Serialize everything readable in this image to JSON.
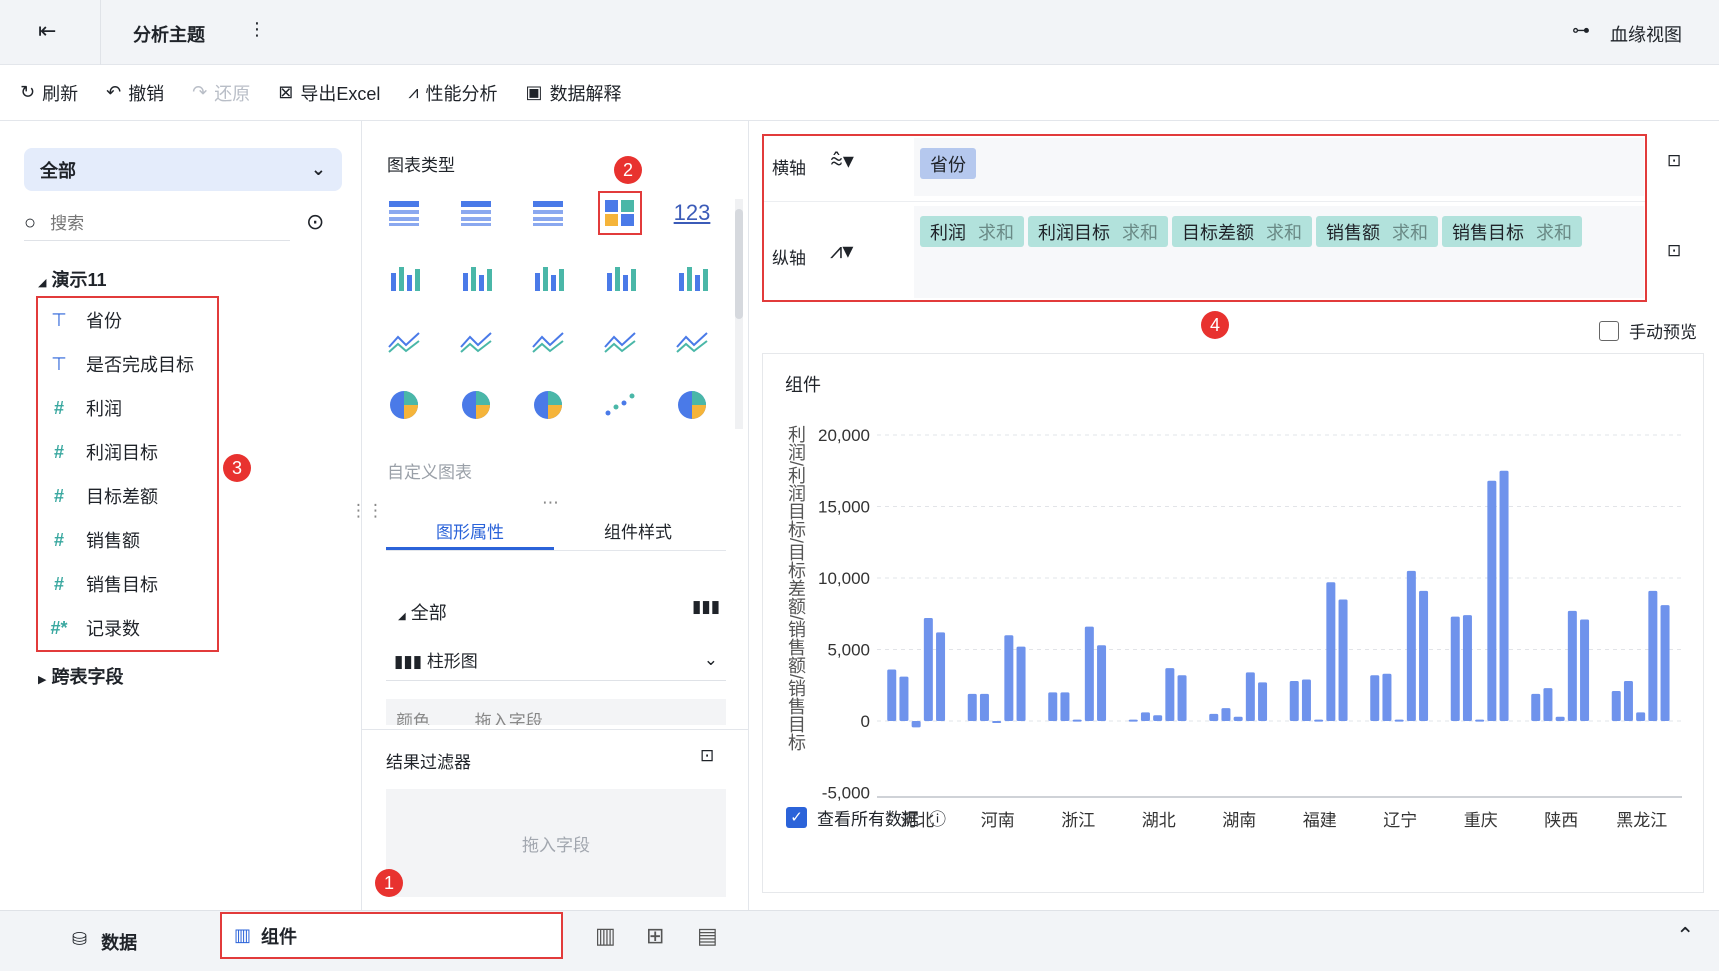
{
  "topbar": {
    "title": "分析主题",
    "lineage": "血缘视图"
  },
  "toolbar": {
    "refresh": "刷新",
    "undo": "撤销",
    "redo": "还原",
    "export": "导出Excel",
    "perf": "性能分析",
    "explain": "数据解释"
  },
  "left": {
    "dropdown": "全部",
    "search_placeholder": "搜索",
    "dataset": "演示11",
    "fields": [
      {
        "type": "T",
        "name": "省份"
      },
      {
        "type": "T",
        "name": "是否完成目标"
      },
      {
        "type": "#",
        "name": "利润"
      },
      {
        "type": "#",
        "name": "利润目标"
      },
      {
        "type": "#",
        "name": "目标差额"
      },
      {
        "type": "#",
        "name": "销售额"
      },
      {
        "type": "#",
        "name": "销售目标"
      },
      {
        "type": "#*",
        "name": "记录数"
      }
    ],
    "cross": "跨表字段"
  },
  "mid": {
    "chart_type_title": "图表类型",
    "custom": "自定义图表",
    "tabs": [
      "图形属性",
      "组件样式"
    ],
    "all": "全部",
    "bar": "柱形图",
    "color_row": "颜色",
    "drag_hint": "拖入字段",
    "filter": "结果过滤器",
    "filter_hint": "拖入字段"
  },
  "axes": {
    "x_label": "横轴",
    "y_label": "纵轴",
    "x_fields": [
      "省份"
    ],
    "y_fields": [
      {
        "name": "利润",
        "agg": "求和"
      },
      {
        "name": "利润目标",
        "agg": "求和"
      },
      {
        "name": "目标差额",
        "agg": "求和"
      },
      {
        "name": "销售额",
        "agg": "求和"
      },
      {
        "name": "销售目标",
        "agg": "求和"
      }
    ],
    "manual_preview": "手动预览"
  },
  "badges": [
    "1",
    "2",
    "3",
    "4"
  ],
  "footer": {
    "view_all": "查看所有数据"
  },
  "bottom": {
    "data_tab": "数据",
    "component_tab": "组件"
  },
  "colors": {
    "bar": "#6f93ec",
    "accent": "#2b63d9",
    "red": "#e23b3b"
  },
  "chart_data": {
    "type": "bar",
    "title": "组件",
    "ylabel": "利润/利润目标/目标差额/销售额/销售目标",
    "ylim": [
      -5000,
      20000
    ],
    "yticks": [
      -5000,
      0,
      5000,
      10000,
      15000,
      20000
    ],
    "ytick_labels": [
      "-5,000",
      "0",
      "5,000",
      "10,000",
      "15,000",
      "20,000"
    ],
    "categories": [
      "河北",
      "河南",
      "浙江",
      "湖北",
      "湖南",
      "福建",
      "辽宁",
      "重庆",
      "陕西",
      "黑龙江"
    ],
    "series": [
      {
        "name": "利润",
        "values": [
          3600,
          1900,
          2000,
          100,
          500,
          2800,
          3200,
          7300,
          1900,
          2100
        ]
      },
      {
        "name": "利润目标",
        "values": [
          3100,
          1900,
          2000,
          600,
          900,
          2900,
          3300,
          7400,
          2300,
          2800
        ]
      },
      {
        "name": "目标差额",
        "values": [
          -450,
          -100,
          100,
          400,
          300,
          100,
          100,
          100,
          300,
          600
        ]
      },
      {
        "name": "销售额",
        "values": [
          7200,
          6000,
          6600,
          3700,
          3400,
          9700,
          10500,
          16800,
          7700,
          9100
        ]
      },
      {
        "name": "销售目标",
        "values": [
          6200,
          5200,
          5300,
          3200,
          2700,
          8500,
          9100,
          17500,
          7100,
          8100
        ]
      }
    ]
  }
}
